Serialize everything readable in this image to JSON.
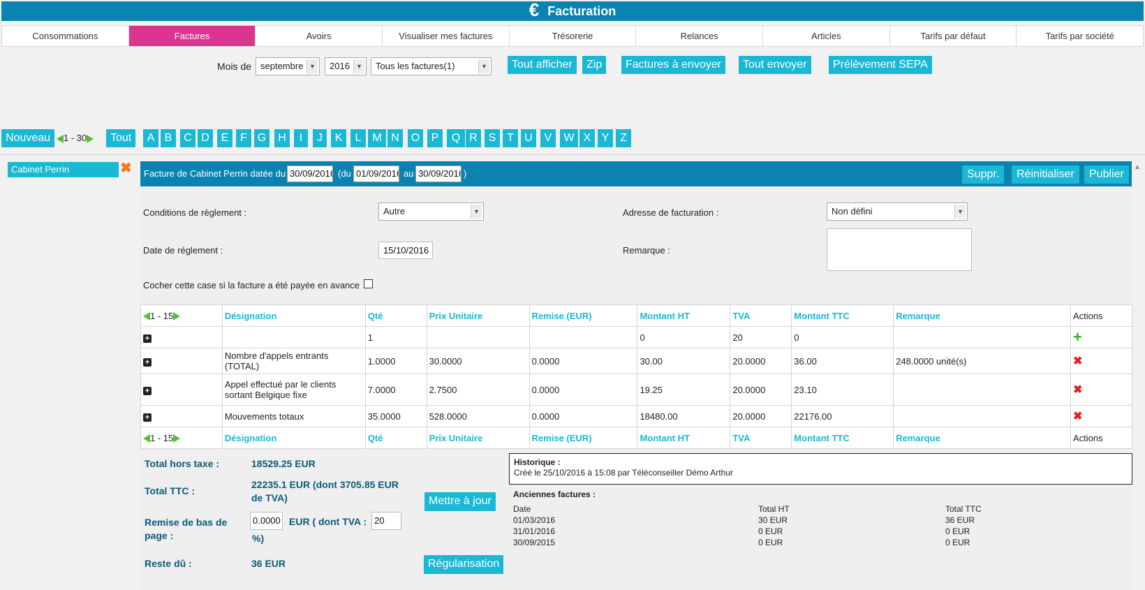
{
  "title": "Facturation",
  "tabs": [
    "Consommations",
    "Factures",
    "Avoirs",
    "Visualiser mes factures",
    "Trésorerie",
    "Relances",
    "Articles",
    "Tarifs par défaut",
    "Tarifs par société"
  ],
  "active_tab": "Factures",
  "filter": {
    "label": "Mois de",
    "month": "septembre",
    "year": "2016",
    "type": "Tous les factures(1)",
    "buttons": [
      "Tout afficher",
      "Zip",
      "Factures à envoyer",
      "Tout envoyer",
      "Prélèvement SEPA"
    ]
  },
  "alpha": {
    "new_label": "Nouveau",
    "range": "1 - 30",
    "all_label": "Tout",
    "letters": [
      "A",
      "B",
      "C",
      "D",
      "E",
      "F",
      "G",
      "H",
      "I",
      "J",
      "K",
      "L",
      "M",
      "N",
      "O",
      "P",
      "Q",
      "R",
      "S",
      "T",
      "U",
      "V",
      "W",
      "X",
      "Y",
      "Z"
    ]
  },
  "sidebar": {
    "client": "Cabinet Perrin"
  },
  "invoice": {
    "title_prefix": "Facture de Cabinet Perrin datée du",
    "date": "30/09/2016",
    "du_label": "(du",
    "from": "01/09/2016",
    "au_label": "au",
    "to": "30/09/2016",
    "close_paren": ")",
    "buttons": [
      "Suppr.",
      "Réinitialiser",
      "Publier"
    ]
  },
  "form": {
    "conditions_label": "Conditions de règlement :",
    "conditions_value": "Autre",
    "address_label": "Adresse de facturation :",
    "address_value": "Non défini",
    "date_label": "Date de réglement :",
    "date_value": "15/10/2016",
    "remark_label": "Remarque :",
    "paid_label": "Cocher cette case si la facture a été payée en avance"
  },
  "table": {
    "range": "1 - 15",
    "headers": [
      "Désignation",
      "Qté",
      "Prix Unitaire",
      "Remise (EUR)",
      "Montant HT",
      "TVA",
      "Montant TTC",
      "Remarque",
      "Actions"
    ],
    "rows": [
      [
        "",
        "1",
        "",
        "",
        "0",
        "20",
        "0",
        ""
      ],
      [
        "Nombre d'appels entrants (TOTAL)",
        "1.0000",
        "30.0000",
        "0.0000",
        "30.00",
        "20.0000",
        "36.00",
        "248.0000 unité(s)"
      ],
      [
        "Appel effectué par le clients sortant Belgique fixe",
        "7.0000",
        "2.7500",
        "0.0000",
        "19.25",
        "20.0000",
        "23.10",
        ""
      ],
      [
        "Mouvements totaux",
        "35.0000",
        "528.0000",
        "0.0000",
        "18480.00",
        "20.0000",
        "22176.00",
        ""
      ]
    ]
  },
  "totals": {
    "ht_label": "Total hors taxe :",
    "ht_value": "18529.25 EUR",
    "ttc_label": "Total TTC :",
    "ttc_value": "22235.1 EUR (dont 3705.85 EUR de TVA)",
    "remise_label": "Remise de bas de page :",
    "remise_value": "0.0000",
    "remise_mid": "EUR ( dont TVA :",
    "remise_tva": "20",
    "remise_end": "%)",
    "reste_label": "Reste dû :",
    "reste_value": "36 EUR",
    "update_btn": "Mettre à jour",
    "regul_btn": "Régularisation"
  },
  "historique": {
    "title": "Historique :",
    "line": "Créé le 25/10/2016 à 15:08 par Téléconseiller Démo Arthur"
  },
  "anciennes": {
    "title": "Anciennes factures :",
    "headers": [
      "Date",
      "Total HT",
      "Total TTC"
    ],
    "rows": [
      [
        "01/03/2016",
        "30 EUR",
        "36 EUR"
      ],
      [
        "31/01/2016",
        "0 EUR",
        "0 EUR"
      ],
      [
        "30/09/2015",
        "0 EUR",
        "0 EUR"
      ]
    ]
  }
}
